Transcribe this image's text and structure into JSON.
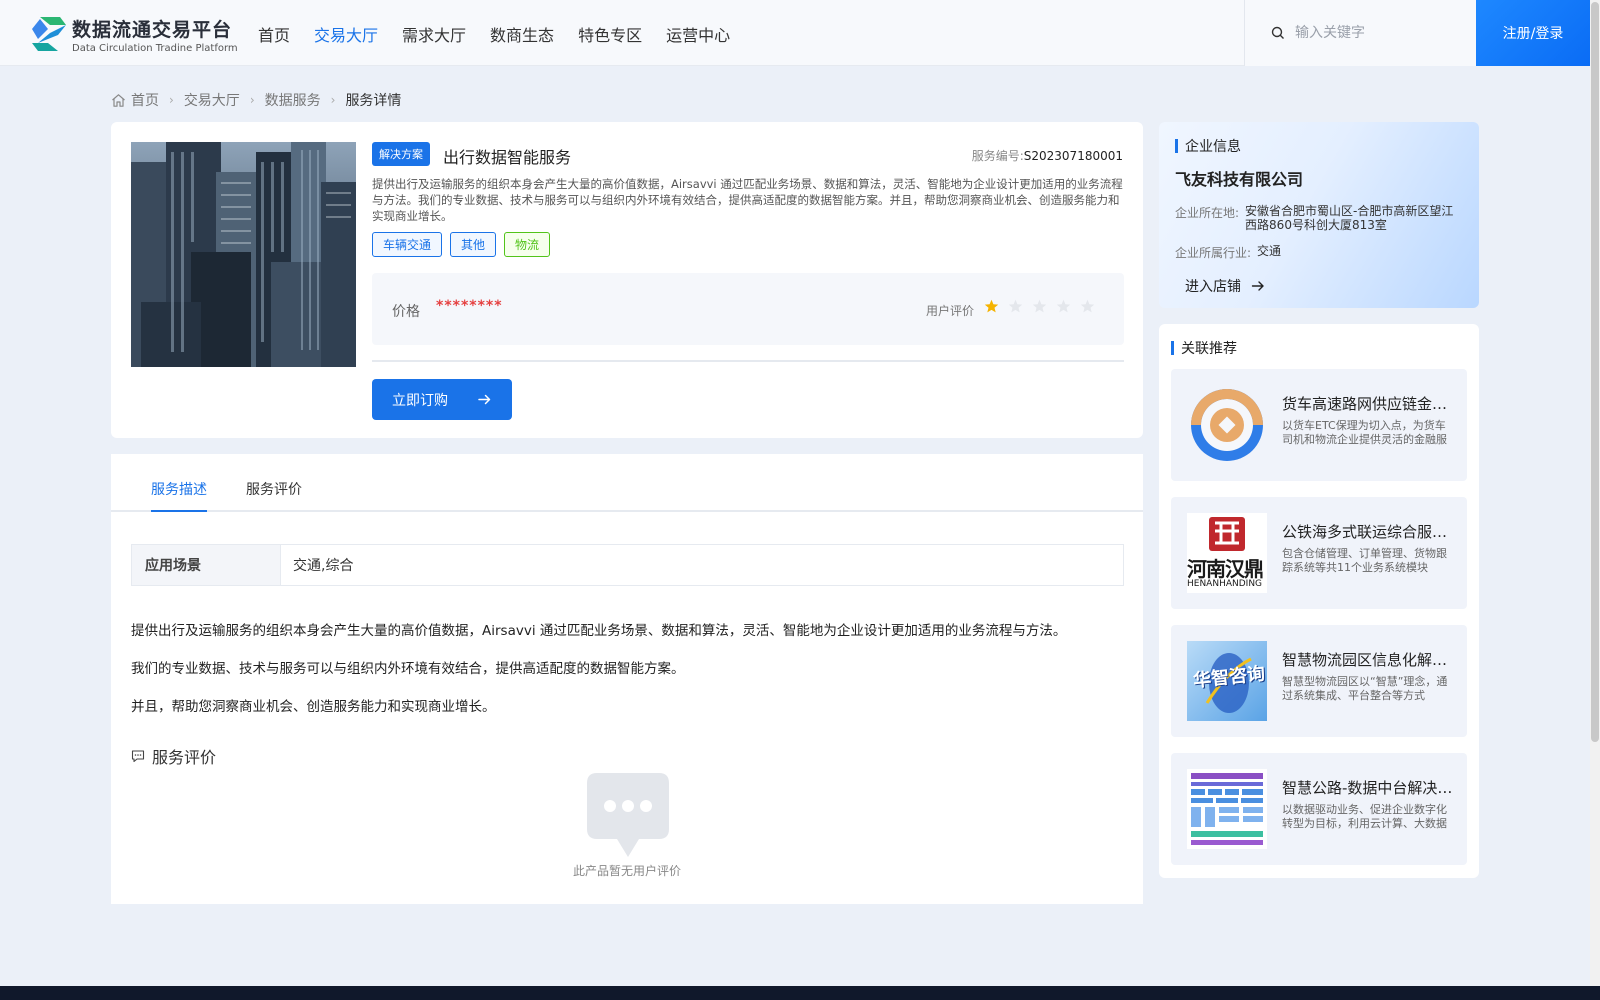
{
  "header": {
    "logo_title": "数据流通交易平台",
    "logo_subtitle": "Data Circulation Tradine Platform",
    "nav": [
      {
        "label": "首页",
        "active": false
      },
      {
        "label": "交易大厅",
        "active": true
      },
      {
        "label": "需求大厅",
        "active": false
      },
      {
        "label": "数商生态",
        "active": false
      },
      {
        "label": "特色专区",
        "active": false
      },
      {
        "label": "运营中心",
        "active": false
      }
    ],
    "search_placeholder": "输入关键字",
    "login_label": "注册/登录"
  },
  "breadcrumb": {
    "home": "首页",
    "level1": "交易大厅",
    "level2": "数据服务",
    "current": "服务详情"
  },
  "product": {
    "badge": "解决方案",
    "title": "出行数据智能服务",
    "service_no_label": "服务编号:",
    "service_no": "S202307180001",
    "description": "提供出行及运输服务的组织本身会产生大量的高价值数据，Airsavvi 通过匹配业务场景、数据和算法，灵活、智能地为企业设计更加适用的业务流程与方法。我们的专业数据、技术与服务可以与组织内外环境有效结合，提供高适配度的数据智能方案。并且，帮助您洞察商业机会、创造服务能力和实现商业增长。",
    "tags": [
      "车辆交通",
      "其他",
      "物流"
    ],
    "price_label": "价格",
    "price_value": "********",
    "rating_label": "用户评价",
    "rating": 1,
    "rating_max": 5,
    "order_button": "立即订购"
  },
  "details": {
    "tabs": [
      "服务描述",
      "服务评价"
    ],
    "active_tab": "服务描述",
    "scene_key": "应用场景",
    "scene_value": "交通,综合",
    "paragraphs": [
      "提供出行及运输服务的组织本身会产生大量的高价值数据，Airsavvi 通过匹配业务场景、数据和算法，灵活、智能地为企业设计更加适用的业务流程与方法。",
      "我们的专业数据、技术与服务可以与组织内外环境有效结合，提供高适配度的数据智能方案。",
      "并且，帮助您洞察商业机会、创造服务能力和实现商业增长。"
    ],
    "review_heading": "服务评价",
    "empty_review_text": "此产品暂无用户评价"
  },
  "company": {
    "heading": "企业信息",
    "name": "飞友科技有限公司",
    "location_label": "企业所在地:",
    "location": "安徽省合肥市蜀山区-合肥市高新区望江西路860号科创大厦813室",
    "industry_label": "企业所属行业:",
    "industry": "交通",
    "enter_shop": "进入店铺"
  },
  "related": {
    "heading": "关联推荐",
    "items": [
      {
        "title": "货车高速路网供应链金融服务",
        "desc": "以货车ETC保理为切入点，为货车司机和物流企业提供灵活的金融服务"
      },
      {
        "title": "公铁海多式联运综合服务平台",
        "desc": "包含仓储管理、订单管理、货物跟踪系统等共11个业务系统模块"
      },
      {
        "title": "智慧物流园区信息化解决方案",
        "desc": "智慧型物流园区以“智慧”理念，通过系统集成、平台整合等方式"
      },
      {
        "title": "智慧公路-数据中台解决方案",
        "desc": "以数据驱动业务、促进企业数字化转型为目标，利用云计算、大数据"
      }
    ],
    "thumb2_text": "河南汉鼎",
    "thumb2_subtext": "HENANHANDING",
    "thumb3_text": "华智咨询"
  },
  "colors": {
    "accent": "#1a73e8",
    "price": "#e54040",
    "star_on": "#f5b300",
    "star_off": "#e4e7ec"
  }
}
